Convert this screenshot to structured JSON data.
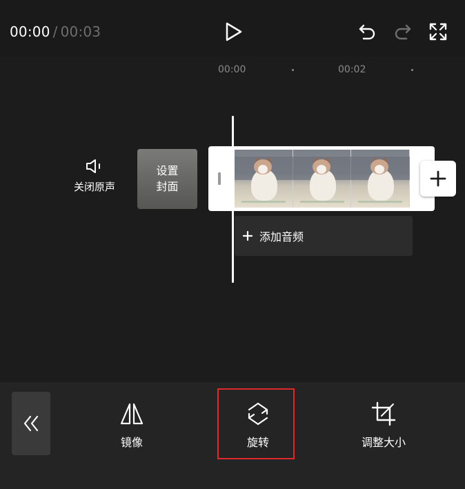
{
  "header": {
    "current_time": "00:00",
    "separator": "/",
    "total_time": "00:03"
  },
  "timeline": {
    "ruler": [
      "00:00",
      "00:02"
    ]
  },
  "track": {
    "mute_label": "关闭原声",
    "cover_label_line1": "设置",
    "cover_label_line2": "封面",
    "add_audio_label": "添加音频"
  },
  "toolbar": {
    "mirror_label": "镜像",
    "rotate_label": "旋转",
    "resize_label": "调整大小"
  },
  "icons": {
    "play": "play-icon",
    "undo": "undo-icon",
    "redo": "redo-icon",
    "fullscreen": "fullscreen-icon",
    "mute": "speaker-mute-icon",
    "add_clip": "plus-icon",
    "add_audio": "plus-icon",
    "collapse": "double-chevron-left-icon",
    "mirror": "mirror-icon",
    "rotate": "rotate-icon",
    "resize": "crop-icon"
  },
  "colors": {
    "background": "#1c1c1c",
    "toolbar": "#242424",
    "highlight": "#e02a2a",
    "muted_text": "#6f6f6f"
  }
}
